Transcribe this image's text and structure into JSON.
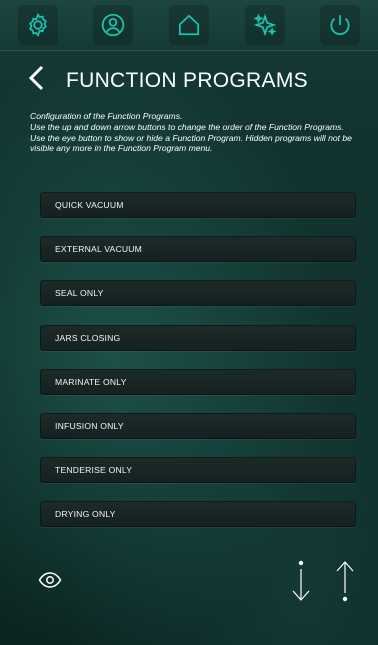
{
  "topbar": {
    "icons": [
      "gear-icon",
      "user-icon",
      "home-icon",
      "sparkle-icon",
      "power-icon"
    ]
  },
  "header": {
    "back_icon": "chevron-left-icon",
    "title": "FUNCTION PROGRAMS"
  },
  "description": {
    "line1": "Configuration of the Function Programs.",
    "line2": "Use the up and down arrow buttons to change the order of the Function Programs.",
    "line3": "Use the eye button to show or hide a Function Program.  Hidden programs will not be visible any more in the Function Program menu."
  },
  "programs": [
    "QUICK VACUUM",
    "EXTERNAL VACUUM",
    "SEAL ONLY",
    "JARS CLOSING",
    "MARINATE ONLY",
    "INFUSION ONLY",
    "TENDERISE ONLY",
    "DRYING ONLY"
  ],
  "controls": {
    "eye_icon": "eye-icon",
    "down_icon": "arrow-down-icon",
    "up_icon": "arrow-up-icon"
  },
  "colors": {
    "accent": "#19c6b0",
    "background": "#0f2a27",
    "button_bg": "#182624"
  }
}
